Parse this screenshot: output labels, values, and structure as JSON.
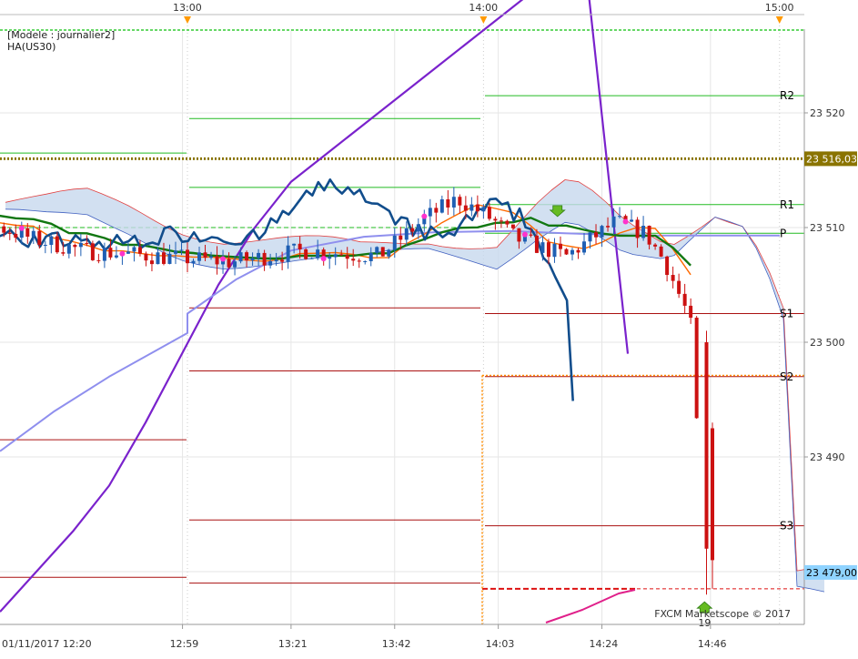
{
  "legend": {
    "model": "[Modele : journalier2]",
    "instrument": "HA(US30)"
  },
  "watermark": "FXCM Marketscope © 2017",
  "top_times": [
    "13:00",
    "14:00",
    "15:00"
  ],
  "x_ticks": [
    "01/11/2017 12:20",
    "12:59",
    "13:21",
    "13:42",
    "14:03",
    "14:24",
    "14:46"
  ],
  "y_ticks": [
    "23 520",
    "23 510",
    "23 500",
    "23 490",
    "23 480"
  ],
  "price_tags": {
    "upper": "23 516,03",
    "current": "23 479,00"
  },
  "pivot_labels": [
    "R2",
    "R1",
    "P",
    "S1",
    "S2",
    "S3"
  ],
  "signal_count": "19",
  "chart_data": {
    "type": "candlestick",
    "instrument": "HA(US30)",
    "y_range": [
      23475,
      23525
    ],
    "pivots_current_session": {
      "R2": 23521.5,
      "R1": 23512,
      "P": 23509.5,
      "S1": 23502.5,
      "S2": 23497,
      "S3": 23484
    },
    "horizontal_levels": {
      "upper_dotted": 23516,
      "lower_dashed": 23478.5
    },
    "signals": [
      {
        "type": "sell",
        "time": "14:15",
        "price": 23511.2
      },
      {
        "type": "buy",
        "time": "14:27",
        "price": 23478,
        "label": "19"
      }
    ],
    "colors": {
      "bull": "#1f5fb3",
      "bear": "#cc1111",
      "kijun": "#117711",
      "tenkan": "#ff6a00",
      "chikou": "#114d8c",
      "long_ma": "#7a22cc",
      "vwap": "#8f8fee",
      "kumo_bull": "#c7d8ee",
      "kumo_bear": "#f7c7c7",
      "pivot_resistance": "#22bb22",
      "pivot_support": "#aa1111"
    }
  }
}
